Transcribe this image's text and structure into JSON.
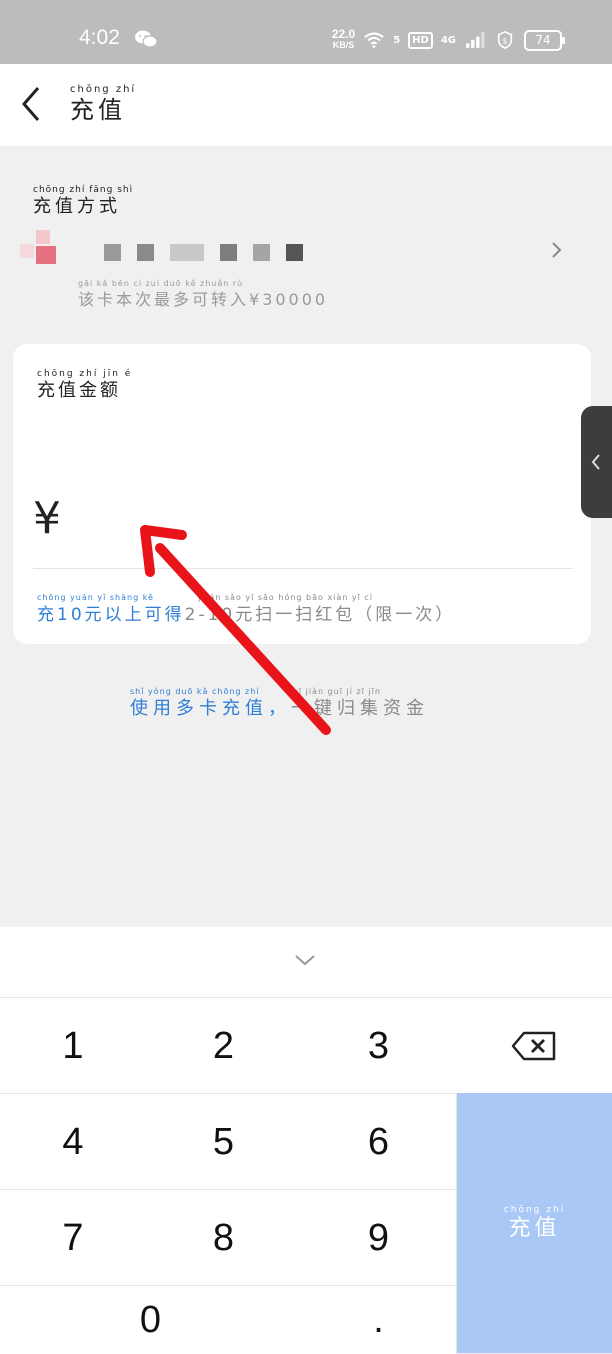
{
  "status_bar": {
    "time": "4:02",
    "net_speed": "22.0",
    "net_unit": "KB/S",
    "wifi_sub": "5",
    "hd": "HD",
    "cell": "4G",
    "battery": "74",
    "icons": [
      "wechat-icon",
      "wifi-icon",
      "shield-icon",
      "battery-icon"
    ]
  },
  "header": {
    "title_pinyin": "chōng zhí",
    "title": "充值"
  },
  "method": {
    "title_pinyin": "chōng zhí fāng shì",
    "title": "充值方式",
    "limit_pinyin": "gāi kǎ běn cì zuì duō kě zhuǎn rù",
    "limit_text": "该卡本次最多可转入",
    "limit_amount": "¥30000"
  },
  "amount": {
    "label_pinyin": "chōng zhí jīn é",
    "label": "充值金额",
    "currency": "¥",
    "value": "",
    "promo_pinyin_blue": "chōng yuán yǐ shàng kě",
    "promo_blue": "充10元以上可得",
    "promo_pinyin_grey": "yuán sǎo yī sǎo hóng bāo  xiàn yī cì",
    "promo_grey": "2-10元扫一扫红包（限一次）"
  },
  "multi_card": {
    "pinyin_blue": "shǐ yòng duō kǎ chōng zhí",
    "blue": "使用多卡充值，",
    "pinyin_grey": "yī jiàn guī jí zī jīn",
    "grey": "一键归集资金"
  },
  "keypad": {
    "keys": [
      "1",
      "2",
      "3",
      "4",
      "5",
      "6",
      "7",
      "8",
      "9",
      "0",
      "."
    ],
    "submit_pinyin": "chōng zhí",
    "submit": "充值"
  },
  "colors": {
    "accent_blue": "#2f7fd6",
    "submit_bg": "#a9c8f5",
    "annotation_red": "#e8141a"
  }
}
